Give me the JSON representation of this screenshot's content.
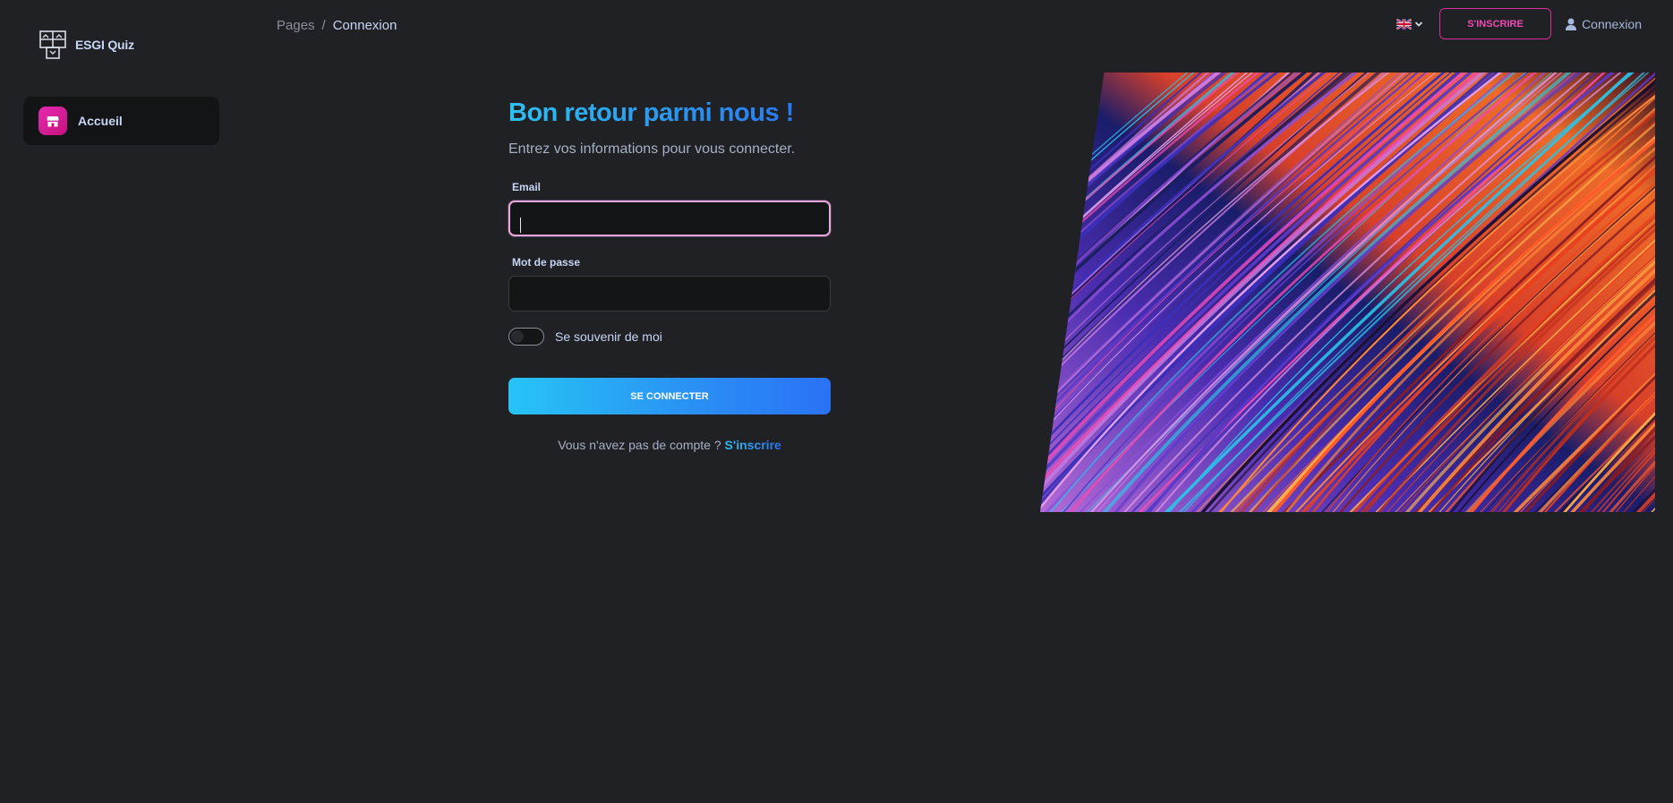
{
  "brand": {
    "name": "ESGI Quiz",
    "logo_icon": "quiz-logo-icon"
  },
  "sidebar": {
    "items": [
      {
        "label": "Accueil",
        "icon": "shop-icon",
        "active": true
      }
    ]
  },
  "header": {
    "breadcrumb": {
      "parent": "Pages",
      "separator": "/",
      "current": "Connexion"
    },
    "language": {
      "flag": "uk-flag-icon",
      "dropdown_icon": "chevron-down-icon"
    },
    "signup_button": "S'INSCRIRE",
    "login_link": "Connexion"
  },
  "form": {
    "title": "Bon retour parmi nous !",
    "subtitle": "Entrez vos informations pour vous connecter.",
    "email": {
      "label": "Email",
      "value": ""
    },
    "password": {
      "label": "Mot de passe",
      "value": ""
    },
    "remember": {
      "label": "Se souvenir de moi",
      "checked": false
    },
    "submit": "SE CONNECTER",
    "footer": {
      "text": "Vous n'avez pas de compte ?",
      "link": "S'inscrire"
    }
  },
  "colors": {
    "background": "#202124",
    "accent_pink": "#e62ab1",
    "accent_blue_start": "#27c4f5",
    "accent_blue_end": "#2a72f5"
  }
}
